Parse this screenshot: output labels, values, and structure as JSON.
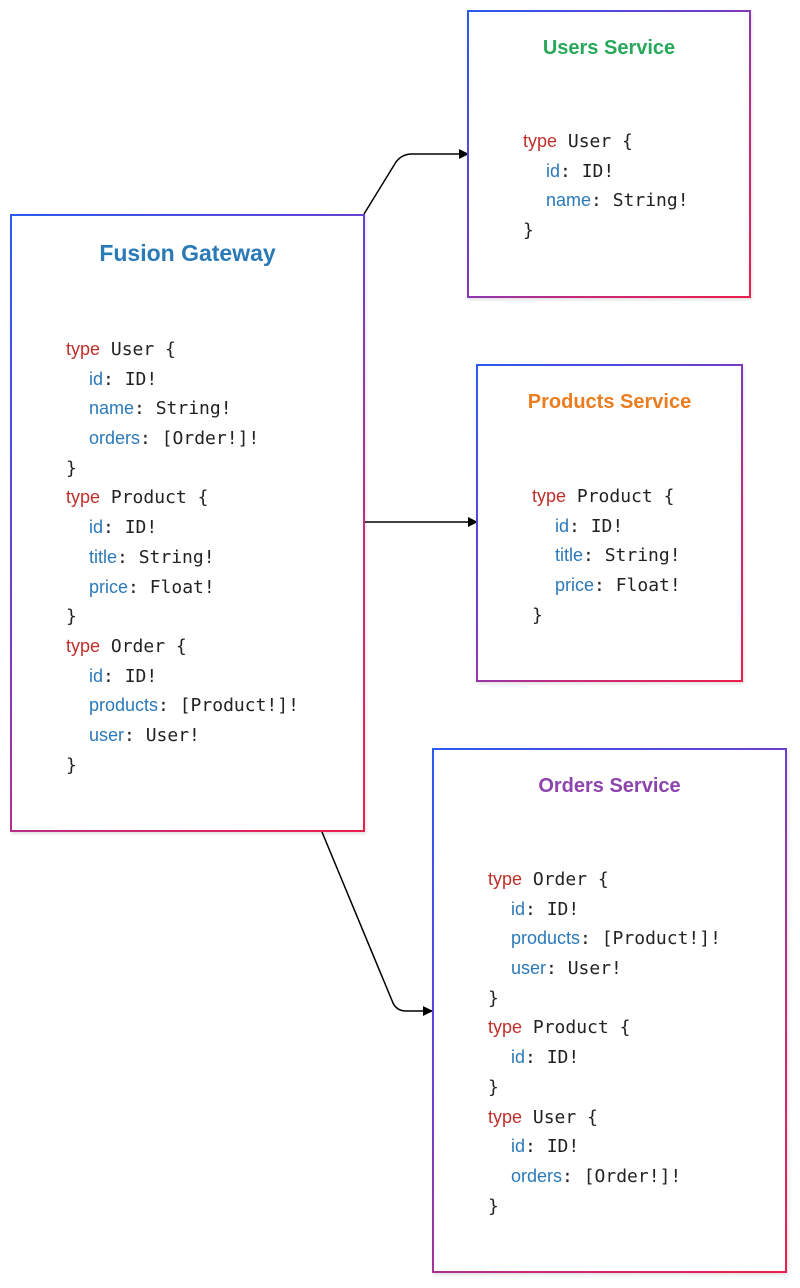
{
  "colors": {
    "gateway_title": "#2a7ab8",
    "users_title": "#27a85a",
    "products_title": "#ec7d1f",
    "orders_title": "#8e44ad",
    "keyword": "#c0302a",
    "field": "#2a79b8",
    "type_text": "#222222"
  },
  "nodes": {
    "gateway": {
      "title": "Fusion Gateway",
      "schema": [
        {
          "kind": "open",
          "keyword": "type",
          "name": "User {"
        },
        {
          "kind": "field",
          "name": "id",
          "type": ": ID!"
        },
        {
          "kind": "field",
          "name": "name",
          "type": ": String!"
        },
        {
          "kind": "field",
          "name": "orders",
          "type": ": [Order!]!"
        },
        {
          "kind": "close",
          "text": "}"
        },
        {
          "kind": "open",
          "keyword": "type",
          "name": "Product {"
        },
        {
          "kind": "field",
          "name": "id",
          "type": ": ID!"
        },
        {
          "kind": "field",
          "name": "title",
          "type": ": String!"
        },
        {
          "kind": "field",
          "name": "price",
          "type": ": Float!"
        },
        {
          "kind": "close",
          "text": "}"
        },
        {
          "kind": "open",
          "keyword": "type",
          "name": "Order {"
        },
        {
          "kind": "field",
          "name": "id",
          "type": ": ID!"
        },
        {
          "kind": "field",
          "name": "products",
          "type": ": [Product!]!"
        },
        {
          "kind": "field",
          "name": "user",
          "type": ": User!"
        },
        {
          "kind": "close",
          "text": "}"
        }
      ]
    },
    "users": {
      "title": "Users Service",
      "schema": [
        {
          "kind": "open",
          "keyword": "type",
          "name": "User {"
        },
        {
          "kind": "field",
          "name": "id",
          "type": ": ID!"
        },
        {
          "kind": "field",
          "name": "name",
          "type": ": String!"
        },
        {
          "kind": "close",
          "text": "}"
        }
      ]
    },
    "products": {
      "title": "Products Service",
      "schema": [
        {
          "kind": "open",
          "keyword": "type",
          "name": "Product {"
        },
        {
          "kind": "field",
          "name": "id",
          "type": ": ID!"
        },
        {
          "kind": "field",
          "name": "title",
          "type": ": String!"
        },
        {
          "kind": "field",
          "name": "price",
          "type": ": Float!"
        },
        {
          "kind": "close",
          "text": "}"
        }
      ]
    },
    "orders": {
      "title": "Orders Service",
      "schema": [
        {
          "kind": "open",
          "keyword": "type",
          "name": "Order {"
        },
        {
          "kind": "field",
          "name": "id",
          "type": ": ID!"
        },
        {
          "kind": "field",
          "name": "products",
          "type": ": [Product!]!"
        },
        {
          "kind": "field",
          "name": "user",
          "type": ": User!"
        },
        {
          "kind": "close",
          "text": "}"
        },
        {
          "kind": "open",
          "keyword": "type",
          "name": "Product {"
        },
        {
          "kind": "field",
          "name": "id",
          "type": ": ID!"
        },
        {
          "kind": "close",
          "text": "}"
        },
        {
          "kind": "open",
          "keyword": "type",
          "name": "User {"
        },
        {
          "kind": "field",
          "name": "id",
          "type": ": ID!"
        },
        {
          "kind": "field",
          "name": "orders",
          "type": ": [Order!]!"
        },
        {
          "kind": "close",
          "text": "}"
        }
      ]
    }
  },
  "edges": [
    {
      "from": "gateway",
      "to": "users"
    },
    {
      "from": "gateway",
      "to": "products"
    },
    {
      "from": "gateway",
      "to": "orders"
    }
  ]
}
